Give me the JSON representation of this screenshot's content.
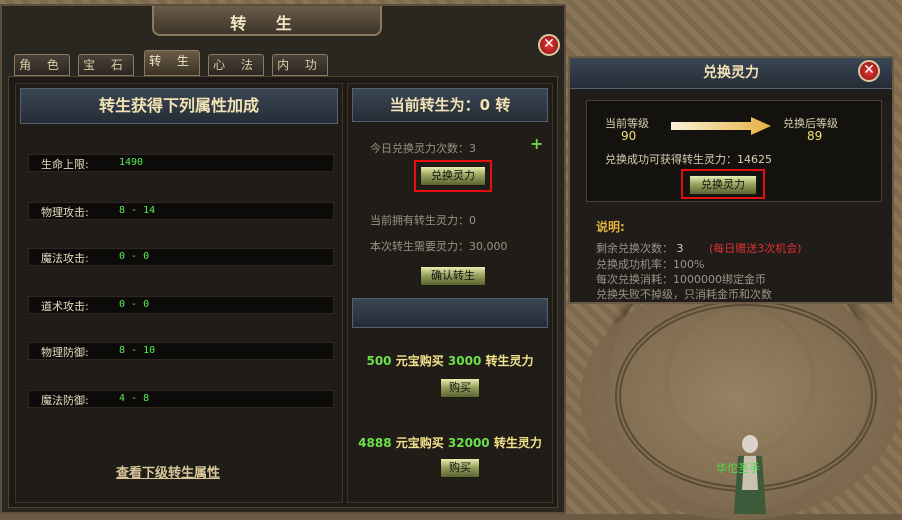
{
  "window": {
    "title": "转 生",
    "tabs": [
      "角 色",
      "宝 石",
      "转 生",
      "心 法",
      "内 功"
    ],
    "active_tab": 2
  },
  "left_panel": {
    "header": "转生获得下列属性加成",
    "attributes": [
      {
        "label": "生命上限:",
        "value": "1490"
      },
      {
        "label": "物理攻击:",
        "value": "8 - 14"
      },
      {
        "label": "魔法攻击:",
        "value": "0 - 0"
      },
      {
        "label": "道术攻击:",
        "value": "0 - 0"
      },
      {
        "label": "物理防御:",
        "value": "8 - 10"
      },
      {
        "label": "魔法防御:",
        "value": "4 - 8"
      }
    ],
    "link": "查看下级转生属性"
  },
  "right_panel": {
    "header": "当前转生为：0 转",
    "daily_exchange": "今日兑换灵力次数：3",
    "exchange_button": "兑换灵力",
    "owned_power": "当前拥有转生灵力：0",
    "required_power": "本次转生需要灵力：30,000",
    "confirm_button": "确认转生",
    "offers": [
      {
        "yuanbao": "500",
        "mid": " 元宝购买 ",
        "power": "3000",
        "end": " 转生灵力",
        "button": "购买"
      },
      {
        "yuanbao": "4888",
        "mid": " 元宝购买 ",
        "power": "32000",
        "end": " 转生灵力",
        "button": "购买"
      }
    ]
  },
  "dialog": {
    "title": "兑换灵力",
    "current_level_label": "当前等级",
    "current_level": "90",
    "after_level_label": "兑换后等级",
    "after_level": "89",
    "gain_text": "兑换成功可获得转生灵力：14625",
    "exchange_button": "兑换灵力",
    "note_title": "说明:",
    "notes": {
      "remaining_label": "剩余兑换次数：",
      "remaining_value": "3",
      "remaining_extra": "(每日赠送3次机会)",
      "success_rate": "兑换成功机率：100%",
      "cost": "每次兑换消耗：1000000绑定金币",
      "fail": "兑换失败不掉级，只消耗金币和次数"
    }
  },
  "npc": {
    "name": "华佗圣手"
  },
  "colors": {
    "highlight_red": "#e41010",
    "value_green": "#57ef57",
    "gold": "#f2e070"
  }
}
